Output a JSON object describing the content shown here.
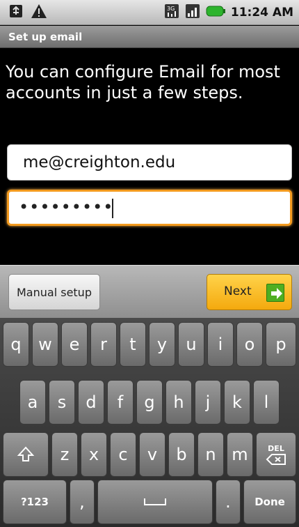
{
  "status_bar": {
    "time": "11:24 AM",
    "icons": [
      "usb-icon",
      "warning-icon",
      "3g-icon",
      "signal-icon",
      "battery-icon"
    ]
  },
  "title_bar": {
    "title": "Set up email"
  },
  "intro": {
    "text": "You can configure Email for most accounts in just a few steps."
  },
  "form": {
    "email_value": "me@creighton.edu",
    "password_value": "•••••••••"
  },
  "buttons": {
    "manual_setup": "Manual setup",
    "next": "Next"
  },
  "keyboard": {
    "row1": [
      "q",
      "w",
      "e",
      "r",
      "t",
      "y",
      "u",
      "i",
      "o",
      "p"
    ],
    "row2": [
      "a",
      "s",
      "d",
      "f",
      "g",
      "h",
      "j",
      "k",
      "l"
    ],
    "row3": [
      "z",
      "x",
      "c",
      "v",
      "b",
      "n",
      "m"
    ],
    "del_label": "DEL",
    "symbols_label": "?123",
    "comma": ",",
    "period": ".",
    "done_label": "Done"
  },
  "colors": {
    "focus_border": "#f39a1e",
    "next_button": "#f4a90e",
    "next_arrow": "#4fae21"
  }
}
